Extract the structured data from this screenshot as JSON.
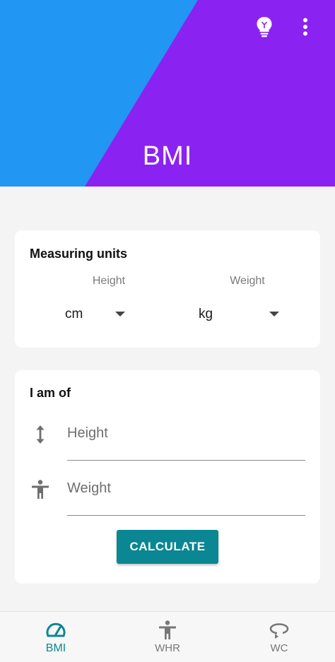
{
  "header": {
    "title": "BMI",
    "icons": {
      "tips": "lightbulb-icon",
      "more": "more-vert-icon"
    },
    "colors": {
      "left": "#2196f3",
      "right": "#8a22f2"
    }
  },
  "units_card": {
    "title": "Measuring units",
    "height_label": "Height",
    "height_value": "cm",
    "weight_label": "Weight",
    "weight_value": "kg"
  },
  "input_card": {
    "title": "I am of",
    "height_placeholder": "Height",
    "weight_placeholder": "Weight",
    "height_icon": "vertical-arrows-icon",
    "weight_icon": "person-icon",
    "calculate_label": "CALCULATE"
  },
  "bottom_nav": {
    "items": [
      {
        "label": "BMI",
        "icon": "speedometer-icon",
        "active": true
      },
      {
        "label": "WHR",
        "icon": "person-icon",
        "active": false
      },
      {
        "label": "WC",
        "icon": "rotate-icon",
        "active": false
      }
    ],
    "accent": "#0b8793"
  }
}
